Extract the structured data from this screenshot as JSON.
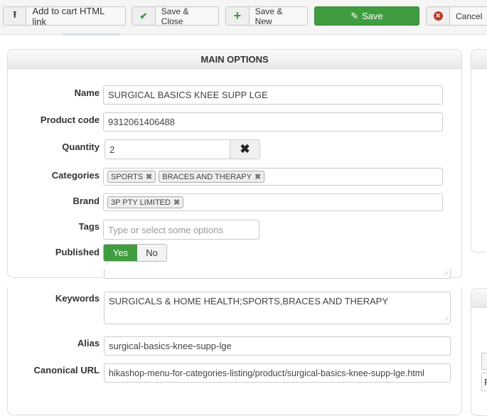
{
  "toolbar": {
    "add_to_cart": "Add to cart HTML link",
    "save_close": "Save & Close",
    "save_new": "Save & New",
    "save": "Save",
    "cancel": "Cancel",
    "colors": {
      "save": "#3f9d3f",
      "check": "#3a9a3a",
      "cancel_icon": "#c0392b"
    }
  },
  "main": {
    "title": "MAIN OPTIONS",
    "name_label": "Name",
    "name_value": "SURGICAL BASICS KNEE SUPP LGE",
    "code_label": "Product code",
    "code_value": "9312061406488",
    "qty_label": "Quantity",
    "qty_value": "2",
    "cat_label": "Categories",
    "categories": [
      "SPORTS",
      "BRACES AND THERAPY"
    ],
    "brand_label": "Brand",
    "brands": [
      "3P PTY LIMITED"
    ],
    "tags_label": "Tags",
    "tags_placeholder": "Type or select some options",
    "published_label": "Published",
    "yes": "Yes",
    "no": "No",
    "published": "Yes"
  },
  "seo": {
    "keywords_label": "Keywords",
    "keywords_value": "SURGICALS & HOME HEALTH;SPORTS,BRACES AND THERAPY",
    "alias_label": "Alias",
    "alias_value": "surgical-basics-knee-supp-lge",
    "canonical_label": "Canonical URL",
    "canonical_value": "hikashop-menu-for-categories-listing/product/surgical-basics-knee-supp-lge.html"
  },
  "side": {
    "fragment": "F"
  }
}
